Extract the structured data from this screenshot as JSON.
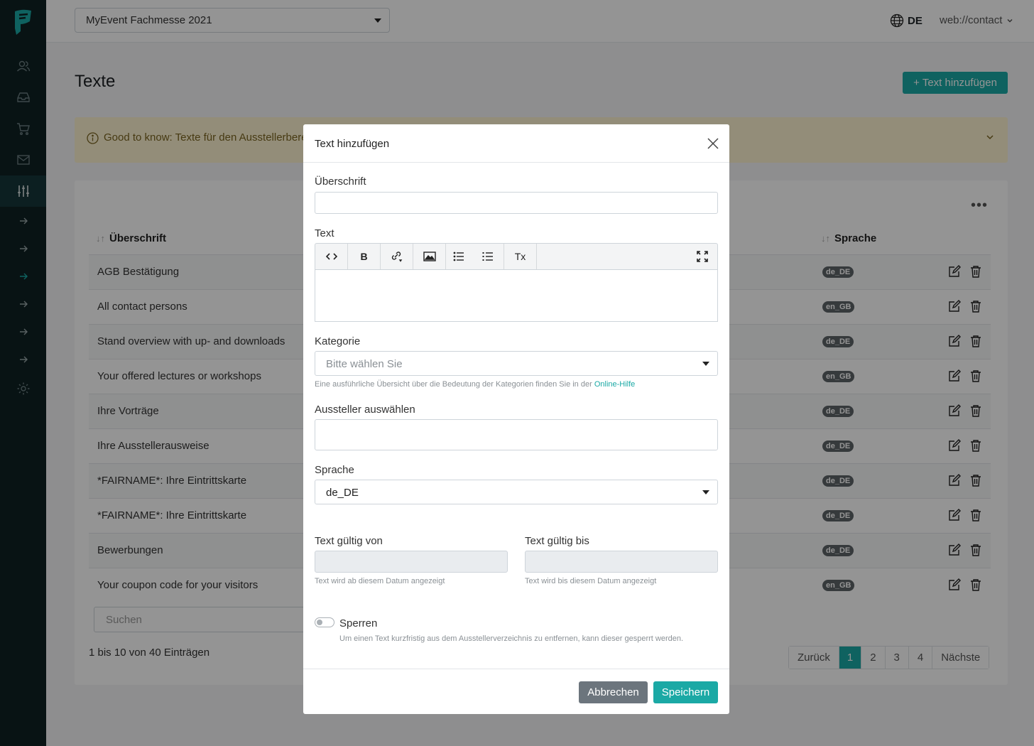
{
  "topbar": {
    "event": "MyEvent Fachmesse 2021",
    "language": "DE",
    "user": "web://contact"
  },
  "page": {
    "title": "Texte",
    "add_button": "Text hinzufügen",
    "notice": "Good to know: Texte für den Ausstellerbereich"
  },
  "table": {
    "col_title": "Überschrift",
    "col_language": "Sprache",
    "rows": [
      {
        "title": "AGB Bestätigung",
        "lang": "de_DE"
      },
      {
        "title": "All contact persons",
        "lang": "en_GB"
      },
      {
        "title": "Stand overview with up- and downloads",
        "lang": "de_DE"
      },
      {
        "title": "Your offered lectures or workshops",
        "lang": "en_GB"
      },
      {
        "title": "Ihre Vorträge",
        "lang": "de_DE"
      },
      {
        "title": "Ihre Ausstellerausweise",
        "lang": "de_DE"
      },
      {
        "title": "*FAIRNAME*: Ihre Eintrittskarte",
        "lang": "de_DE"
      },
      {
        "title": "*FAIRNAME*: Ihre Eintrittskarte",
        "lang": "de_DE"
      },
      {
        "title": "Bewerbungen",
        "lang": "de_DE"
      },
      {
        "title": "Your coupon code for your visitors",
        "lang": "en_GB"
      }
    ],
    "search_placeholder": "Suchen",
    "entries_info": "1 bis 10 von 40 Einträgen",
    "pager": {
      "prev": "Zurück",
      "pages": [
        "1",
        "2",
        "3",
        "4"
      ],
      "next": "Nächste",
      "current": "1"
    }
  },
  "modal": {
    "title": "Text hinzufügen",
    "heading_label": "Überschrift",
    "heading_value": "",
    "text_label": "Text",
    "toolbar": {
      "bold": "B",
      "clear_format": "Tx"
    },
    "category_label": "Kategorie",
    "category_placeholder": "Bitte wählen Sie",
    "category_help": "Eine ausführliche Übersicht über die Bedeutung der Kategorien finden Sie in der",
    "category_help_link": "Online-Hilfe",
    "exhibitor_label": "Aussteller auswählen",
    "language_label": "Sprache",
    "language_value": "de_DE",
    "valid_from_label": "Text gültig von",
    "valid_from_help": "Text wird ab diesem Datum angezeigt",
    "valid_to_label": "Text gültig bis",
    "valid_to_help": "Text wird bis diesem Datum angezeigt",
    "lock_label": "Sperren",
    "lock_help": "Um einen Text kurzfristig aus dem Ausstellerverzeichnis zu entfernen, kann dieser gesperrt werden.",
    "cancel": "Abbrechen",
    "save": "Speichern"
  },
  "colors": {
    "accent": "#1ba9a5",
    "sidebar": "#0e2124",
    "notice": "#fdf3d1"
  }
}
